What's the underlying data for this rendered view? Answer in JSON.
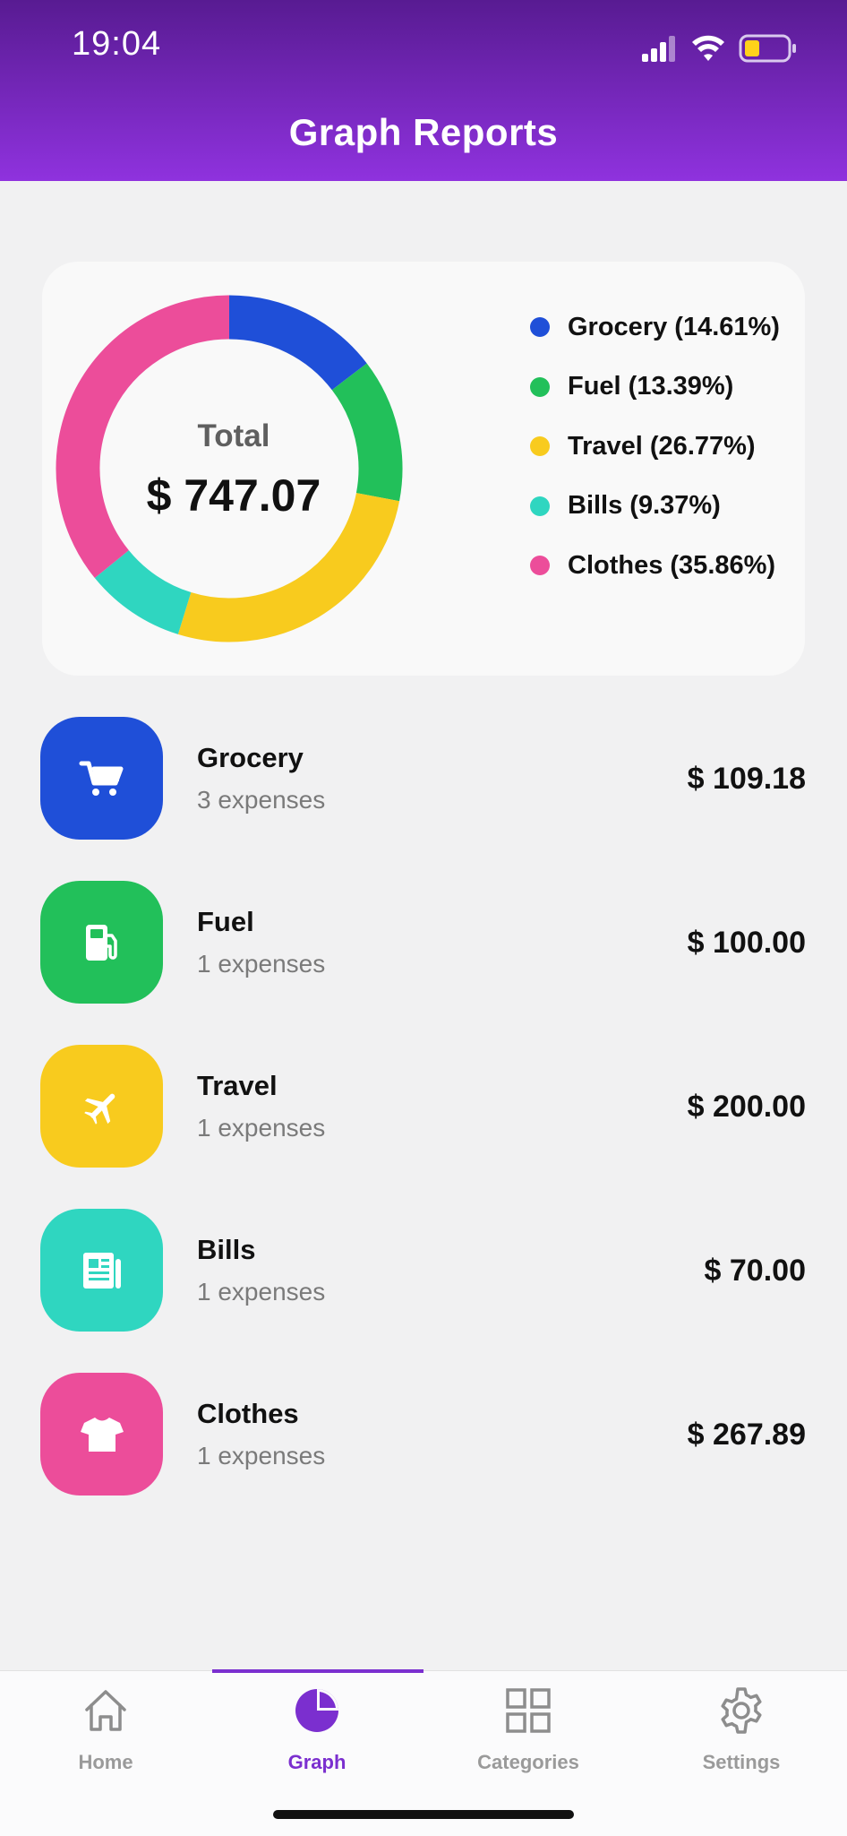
{
  "status_bar": {
    "time": "19:04"
  },
  "header": {
    "title": "Graph Reports"
  },
  "summary": {
    "total_label": "Total",
    "total_value": "$ 747.07"
  },
  "chart_data": {
    "type": "pie",
    "categories": [
      "Grocery",
      "Fuel",
      "Travel",
      "Bills",
      "Clothes"
    ],
    "values": [
      14.61,
      13.39,
      26.77,
      9.37,
      35.86
    ],
    "colors": [
      "#1f4fd8",
      "#22c05a",
      "#f8cb1e",
      "#2fd6c0",
      "#ec4d9a"
    ],
    "legend": [
      "Grocery (14.61%)",
      "Fuel (13.39%)",
      "Travel (26.77%)",
      "Bills (9.37%)",
      "Clothes (35.86%)"
    ],
    "legend_placement": "right"
  },
  "categories": [
    {
      "name": "Grocery",
      "count": "3 expenses",
      "amount": "$ 109.18",
      "color": "#1f4fd8",
      "icon": "cart-icon"
    },
    {
      "name": "Fuel",
      "count": "1 expenses",
      "amount": "$ 100.00",
      "color": "#22c05a",
      "icon": "fuel-pump-icon"
    },
    {
      "name": "Travel",
      "count": "1 expenses",
      "amount": "$ 200.00",
      "color": "#f8cb1e",
      "icon": "airplane-icon"
    },
    {
      "name": "Bills",
      "count": "1 expenses",
      "amount": "$ 70.00",
      "color": "#2fd6c0",
      "icon": "receipt-icon"
    },
    {
      "name": "Clothes",
      "count": "1 expenses",
      "amount": "$ 267.89",
      "color": "#ec4d9a",
      "icon": "tshirt-icon"
    }
  ],
  "tabbar": {
    "tabs": [
      {
        "label": "Home",
        "icon": "home-icon"
      },
      {
        "label": "Graph",
        "icon": "pie-chart-icon"
      },
      {
        "label": "Categories",
        "icon": "grid-icon"
      },
      {
        "label": "Settings",
        "icon": "gear-icon"
      }
    ],
    "active": "Graph",
    "accent": "#7b2fcf"
  }
}
